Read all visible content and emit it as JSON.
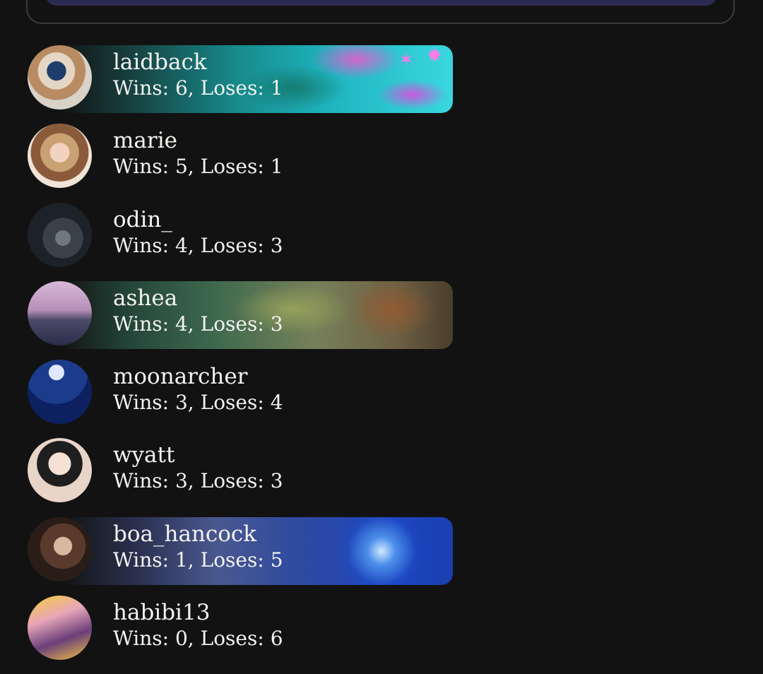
{
  "players": [
    {
      "name": "laidback",
      "wins": "Wins: 6, Loses: 1",
      "banner": "graffiti"
    },
    {
      "name": "marie",
      "wins": "Wins: 5, Loses: 1",
      "banner": "none"
    },
    {
      "name": "odin_",
      "wins": "Wins: 4, Loses: 3",
      "banner": "none"
    },
    {
      "name": "ashea",
      "wins": "Wins: 4, Loses: 3",
      "banner": "meadow"
    },
    {
      "name": "moonarcher",
      "wins": "Wins: 3, Loses: 4",
      "banner": "none"
    },
    {
      "name": "wyatt",
      "wins": "Wins: 3, Loses: 3",
      "banner": "none"
    },
    {
      "name": "boa_hancock",
      "wins": "Wins: 1, Loses: 5",
      "banner": "blue"
    },
    {
      "name": "habibi13",
      "wins": "Wins: 0, Loses: 6",
      "banner": "none"
    }
  ],
  "colors": {
    "background": "#121212",
    "text": "#f3f3f0",
    "top_bar": "#2b2a52"
  }
}
